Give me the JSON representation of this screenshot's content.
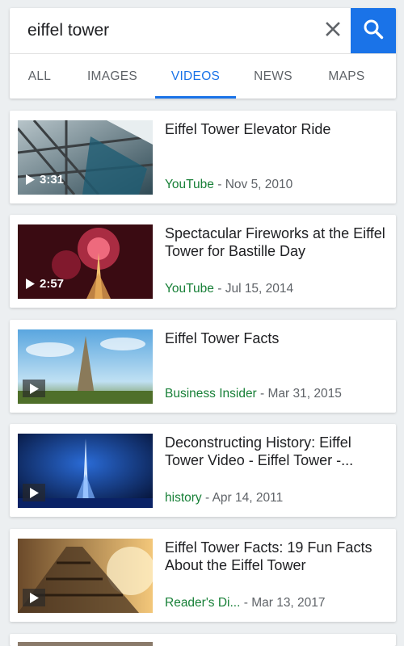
{
  "search": {
    "query": "eiffel tower"
  },
  "tabs": [
    {
      "label": "ALL"
    },
    {
      "label": "IMAGES"
    },
    {
      "label": "VIDEOS"
    },
    {
      "label": "NEWS"
    },
    {
      "label": "MAPS"
    }
  ],
  "active_tab": "VIDEOS",
  "results": [
    {
      "title": "Eiffel Tower Elevator Ride",
      "source": "YouTube",
      "date": " - Nov 5, 2010",
      "duration": "3:31"
    },
    {
      "title": "Spectacular Fireworks at the Eiffel Tower for Bastille Day",
      "source": "YouTube",
      "date": " - Jul 15, 2014",
      "duration": "2:57"
    },
    {
      "title": "Eiffel Tower Facts",
      "source": "Business Insider",
      "date": " - Mar 31, 2015",
      "duration": ""
    },
    {
      "title": "Deconstructing History: Eiffel Tower Video - Eiffel Tower -...",
      "source": "history",
      "date": " - Apr 14, 2011",
      "duration": ""
    },
    {
      "title": "Eiffel Tower Facts: 19 Fun Facts About the Eiffel Tower",
      "source": "Reader's Di...",
      "date": " - Mar 13, 2017",
      "duration": ""
    }
  ],
  "colors": {
    "accent": "#1a73e8",
    "source_green": "#188038",
    "background": "#eceff1"
  },
  "icons": {
    "clear": "close-icon",
    "search": "search-icon",
    "play": "play-icon"
  }
}
